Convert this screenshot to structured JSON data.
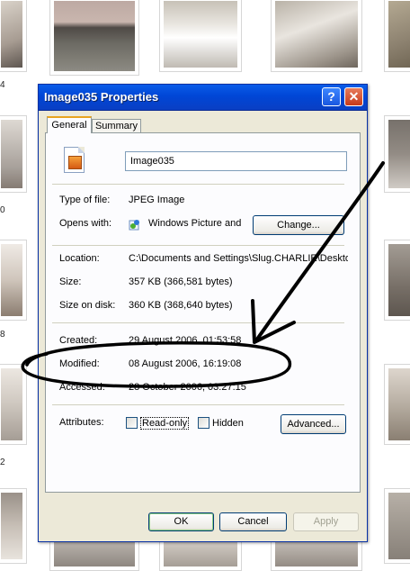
{
  "background": {
    "edge_numbers": [
      "4",
      "0",
      "8",
      "2"
    ]
  },
  "dialog": {
    "title": "Image035 Properties",
    "help_label": "?",
    "close_label": "✕",
    "tabs": [
      "General",
      "Summary"
    ],
    "file_name": "Image035",
    "rows": {
      "type_label": "Type of file:",
      "type_value": "JPEG Image",
      "opens_label": "Opens with:",
      "opens_value": "Windows Picture and F",
      "change_button": "Change...",
      "location_label": "Location:",
      "location_value": "C:\\Documents and Settings\\Slug.CHARLIE\\Deskto",
      "size_label": "Size:",
      "size_value": "357 KB (366,581 bytes)",
      "disk_label": "Size on disk:",
      "disk_value": "360 KB (368,640 bytes)",
      "created_label": "Created:",
      "created_value": "29 August 2006, 01:53:58",
      "modified_label": "Modified:",
      "modified_value": "08 August 2006, 16:19:08",
      "accessed_label": "Accessed:",
      "accessed_value": "28 October 2006, 03:27:15",
      "attributes_label": "Attributes:",
      "readonly_label": "Read-only",
      "hidden_label": "Hidden",
      "advanced_button": "Advanced..."
    },
    "footer": {
      "ok": "OK",
      "cancel": "Cancel",
      "apply": "Apply"
    }
  },
  "annotation": {
    "color": "#000000"
  }
}
